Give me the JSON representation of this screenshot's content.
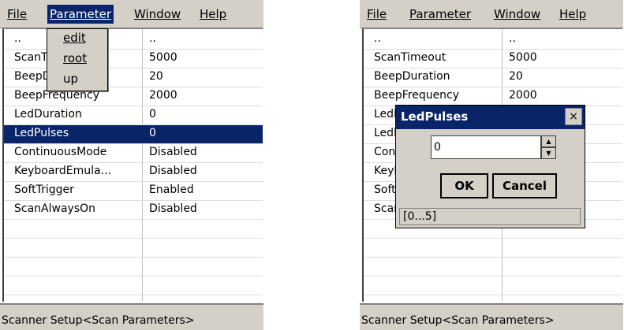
{
  "left_screen": {
    "menubar": {
      "file": "File",
      "parameter": "Parameter",
      "window": "Window",
      "help": "Help"
    },
    "dropdown": {
      "items": [
        "edit",
        "root",
        "up"
      ]
    },
    "rows": [
      {
        "name": "..",
        "value": ".."
      },
      {
        "name": "ScanTimeout",
        "value": "5000"
      },
      {
        "name": "BeepDuration",
        "value": "20"
      },
      {
        "name": "BeepFrequency",
        "value": "2000"
      },
      {
        "name": "LedDuration",
        "value": "0"
      },
      {
        "name": "LedPulses",
        "value": "0"
      },
      {
        "name": "ContinuousMode",
        "value": "Disabled"
      },
      {
        "name": "KeyboardEmula...",
        "value": "Disabled"
      },
      {
        "name": "SoftTrigger",
        "value": "Enabled"
      },
      {
        "name": "ScanAlwaysOn",
        "value": "Disabled"
      }
    ],
    "selected_row": "LedPulses",
    "status": "Scanner Setup<Scan Parameters>"
  },
  "right_screen": {
    "menubar": {
      "file": "File",
      "parameter": "Parameter",
      "window": "Window",
      "help": "Help"
    },
    "rows": [
      {
        "name": "..",
        "value": ".."
      },
      {
        "name": "ScanTimeout",
        "value": "5000"
      },
      {
        "name": "BeepDuration",
        "value": "20"
      },
      {
        "name": "BeepFrequency",
        "value": "2000"
      },
      {
        "name": "LedDuration",
        "value": ""
      },
      {
        "name": "LedPulses",
        "value": ""
      },
      {
        "name": "ContinuousMode",
        "value": ""
      },
      {
        "name": "KeyboardEmula...",
        "value": ""
      },
      {
        "name": "SoftTrigger",
        "value": ""
      },
      {
        "name": "ScanAlwaysOn",
        "value": ""
      }
    ],
    "dialog": {
      "title": "LedPulses",
      "close": "×",
      "value": "0",
      "ok_label": "OK",
      "cancel_label": "Cancel",
      "range": "[0...5]"
    },
    "status": "Scanner Setup<Scan Parameters>"
  },
  "icons": {
    "close": "close-icon",
    "spin_up": "triangle-up-icon",
    "spin_down": "triangle-down-icon"
  },
  "colors": {
    "selection": "#0a246a",
    "chrome": "#d4d0c8"
  }
}
